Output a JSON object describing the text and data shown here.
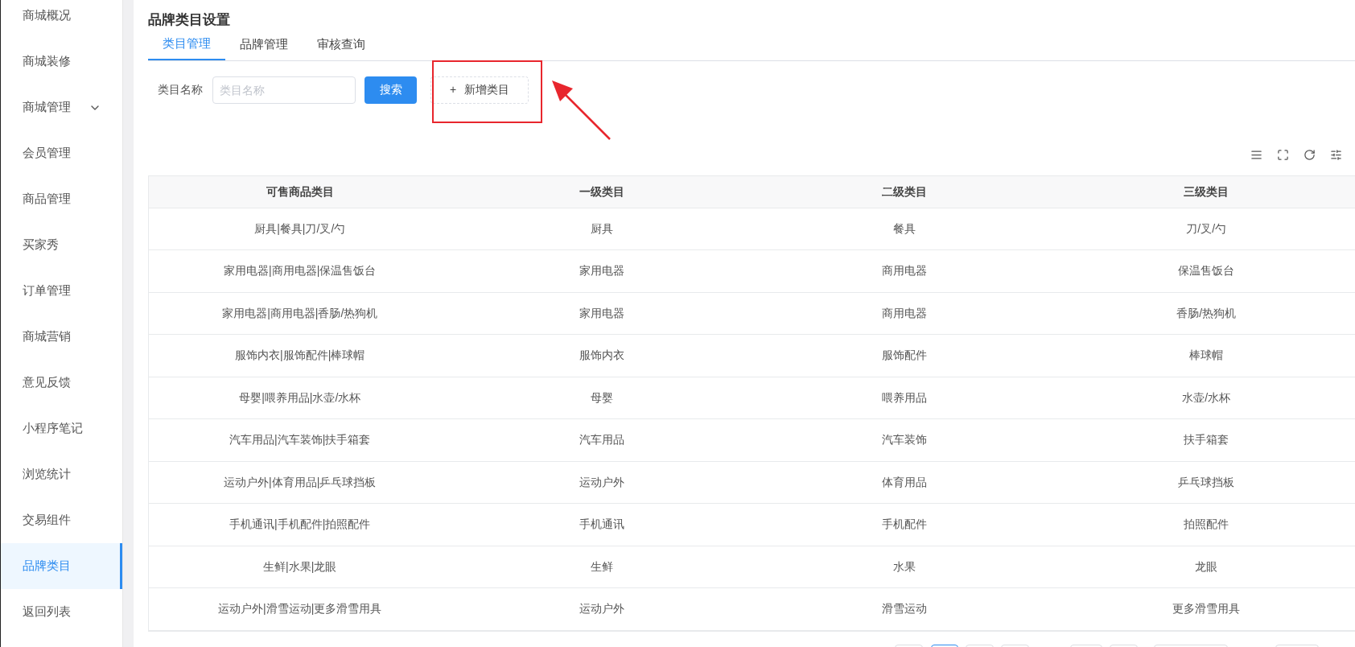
{
  "sidebar": {
    "items": [
      {
        "label": "商城概况",
        "selected": false,
        "expandable": false
      },
      {
        "label": "商城装修",
        "selected": false,
        "expandable": false
      },
      {
        "label": "商城管理",
        "selected": false,
        "expandable": true
      },
      {
        "label": "会员管理",
        "selected": false,
        "expandable": false
      },
      {
        "label": "商品管理",
        "selected": false,
        "expandable": false
      },
      {
        "label": "买家秀",
        "selected": false,
        "expandable": false
      },
      {
        "label": "订单管理",
        "selected": false,
        "expandable": false
      },
      {
        "label": "商城营销",
        "selected": false,
        "expandable": false
      },
      {
        "label": "意见反馈",
        "selected": false,
        "expandable": false
      },
      {
        "label": "小程序笔记",
        "selected": false,
        "expandable": false
      },
      {
        "label": "浏览统计",
        "selected": false,
        "expandable": false
      },
      {
        "label": "交易组件",
        "selected": false,
        "expandable": false
      },
      {
        "label": "品牌类目",
        "selected": true,
        "expandable": false
      },
      {
        "label": "返回列表",
        "selected": false,
        "expandable": false
      }
    ]
  },
  "page_title": "品牌类目设置",
  "tabs": [
    {
      "label": "类目管理",
      "selected": true
    },
    {
      "label": "品牌管理",
      "selected": false
    },
    {
      "label": "审核查询",
      "selected": false
    }
  ],
  "search": {
    "label": "类目名称",
    "placeholder": "类目名称",
    "button": "搜索"
  },
  "add_button": {
    "icon": "+",
    "label": "新增类目"
  },
  "table": {
    "columns": [
      "可售商品类目",
      "一级类目",
      "二级类目",
      "三级类目"
    ],
    "rows": [
      [
        "厨具|餐具|刀/叉/勺",
        "厨具",
        "餐具",
        "刀/叉/勺"
      ],
      [
        "家用电器|商用电器|保温售饭台",
        "家用电器",
        "商用电器",
        "保温售饭台"
      ],
      [
        "家用电器|商用电器|香肠/热狗机",
        "家用电器",
        "商用电器",
        "香肠/热狗机"
      ],
      [
        "服饰内衣|服饰配件|棒球帽",
        "服饰内衣",
        "服饰配件",
        "棒球帽"
      ],
      [
        "母婴|喂养用品|水壶/水杯",
        "母婴",
        "喂养用品",
        "水壶/水杯"
      ],
      [
        "汽车用品|汽车装饰|扶手箱套",
        "汽车用品",
        "汽车装饰",
        "扶手箱套"
      ],
      [
        "运动户外|体育用品|乒乓球挡板",
        "运动户外",
        "体育用品",
        "乒乓球挡板"
      ],
      [
        "手机通讯|手机配件|拍照配件",
        "手机通讯",
        "手机配件",
        "拍照配件"
      ],
      [
        "生鲜|水果|龙眼",
        "生鲜",
        "水果",
        "龙眼"
      ],
      [
        "运动户外|滑雪运动|更多滑雪用具",
        "运动户外",
        "滑雪运动",
        "更多滑雪用具"
      ]
    ]
  },
  "pagination": [
    {
      "selected": false
    },
    {
      "selected": true
    },
    {
      "selected": false
    },
    {
      "selected": false
    },
    {
      "selected": false
    },
    {
      "selected": false
    },
    {
      "selected": false
    },
    {
      "selected": false
    }
  ]
}
